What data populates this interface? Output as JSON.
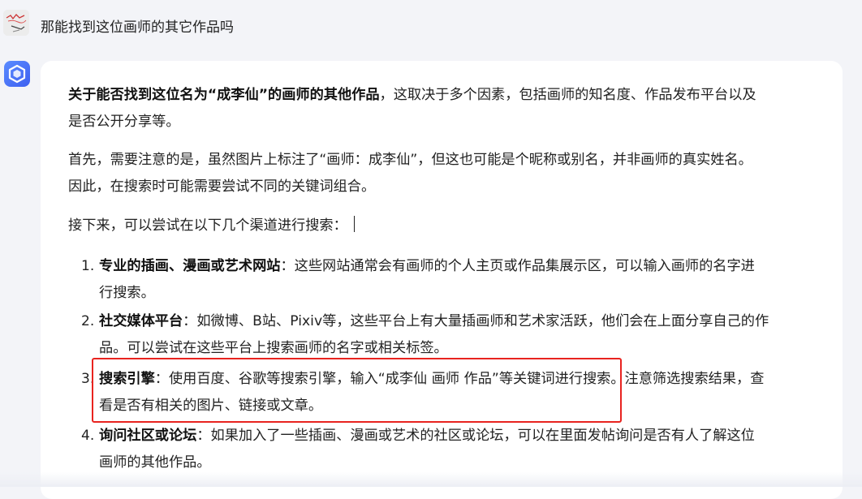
{
  "user": {
    "question": "那能找到这位画师的其它作品吗"
  },
  "assistant": {
    "p1_bold": "关于能否找到这位名为“成李仙”的画师的其他作品",
    "p1_rest_line1": "，这取决于多个因素，包括画师的知名度、作品发布平台以及",
    "p1_rest_line2": "是否公开分享等。",
    "p2_line1": "首先，需要注意的是，虽然图片上标注了“画师：成李仙”，但这也可能是个昵称或别名，并非画师的真实姓名。",
    "p2_line2": "因此，在搜索时可能需要尝试不同的关键词组合。",
    "p3": "接下来，可以尝试在以下几个渠道进行搜索：",
    "items": [
      {
        "num": "1.",
        "title": "专业的插画、漫画或艺术网站",
        "line1": "：这些网站通常会有画师的个人主页或作品集展示区，可以输入画师的名字进",
        "line2": "行搜索。"
      },
      {
        "num": "2.",
        "title": "社交媒体平台",
        "line1": "：如微博、B站、Pixiv等，这些平台上有大量插画师和艺术家活跃，他们会在上面分享自己的作",
        "line2": "品。可以尝试在这些平台上搜索画师的名字或相关标签。"
      },
      {
        "num": "3.",
        "title": "搜索引擎",
        "line1": "：使用百度、谷歌等搜索引擎，输入“成李仙 画师 作品”等关键词进行搜索。注意筛选搜索结果，查",
        "line2": "看是否有相关的图片、链接或文章。"
      },
      {
        "num": "4.",
        "title": "询问社区或论坛",
        "line1": "：如果加入了一些插画、漫画或艺术的社区或论坛，可以在里面发帖询问是否有人了解这位",
        "line2": "画师的其他作品。"
      }
    ]
  },
  "colors": {
    "background": "#f3f4f8",
    "card": "#ffffff",
    "highlight": "#e8231f",
    "bot_avatar": "#4a6ef5"
  },
  "icons": {
    "user_avatar": "user-avatar-image",
    "bot_avatar": "assistant-cube-icon"
  }
}
